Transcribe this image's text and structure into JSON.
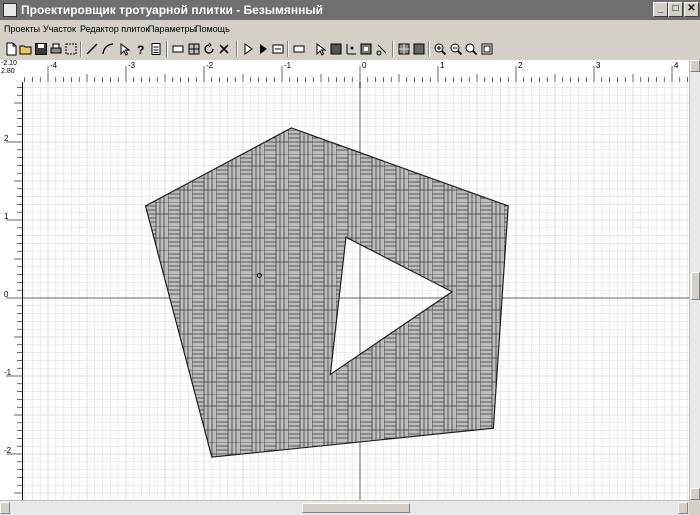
{
  "window": {
    "title": "Проектировщик тротуарной плитки - Безымянный",
    "controls": {
      "minimize": "_",
      "maximize": "□",
      "close": "✕"
    }
  },
  "menu": [
    "Проекты",
    "Участок",
    "Редактор плиток",
    "Параметры",
    "Помощь"
  ],
  "toolbar": {
    "buttons": [
      "new-project-icon",
      "open-project-icon",
      "save-project-icon",
      "print-icon",
      "select-area-icon",
      "draw-line-icon",
      "draw-arc-icon",
      "select-pointer-icon",
      "help-icon",
      "calculator-icon",
      "rectangle-icon",
      "tile-pattern-icon",
      "rotate-icon",
      "delete-icon",
      "pointer-outline-icon",
      "pointer-filled-icon",
      "fit-width-icon",
      "tile-outline-icon",
      "select-node-icon",
      "fill-square-icon",
      "node-axes-icon",
      "fill-node-icon",
      "cut-node-icon",
      "tile-grid-icon",
      "tile-fill-icon",
      "zoom-in-icon",
      "zoom-out-icon",
      "zoom-icon",
      "zoom-fit-icon"
    ]
  },
  "corner": {
    "x": "-2.10",
    "y": "2.80"
  },
  "rulers": {
    "x_labels": [
      "-4",
      "-3",
      "-2",
      "-1",
      "0",
      "1",
      "2",
      "3",
      "4"
    ],
    "y_labels": [
      "2",
      "1",
      "0",
      "-1",
      "-2"
    ]
  },
  "drawing": {
    "outer_polygon": [
      [
        -0.88,
        2.18
      ],
      [
        1.9,
        1.18
      ],
      [
        1.71,
        -1.67
      ],
      [
        -1.9,
        -2.04
      ],
      [
        -2.75,
        1.18
      ]
    ],
    "inner_cutout": [
      [
        -0.18,
        0.78
      ],
      [
        1.18,
        0.08
      ],
      [
        -0.38,
        -0.98
      ]
    ],
    "origin_marker": [
      -1.29,
      0.29
    ]
  },
  "colors": {
    "titlebar": "#6f6f6f",
    "chrome": "#d4d0c8",
    "grid_minor": "#e2e2e2",
    "grid_major": "#c6c6c6",
    "axes": "#666666",
    "tile_fill": "#bdbdbd",
    "tile_stroke": "#3c3c3c"
  }
}
